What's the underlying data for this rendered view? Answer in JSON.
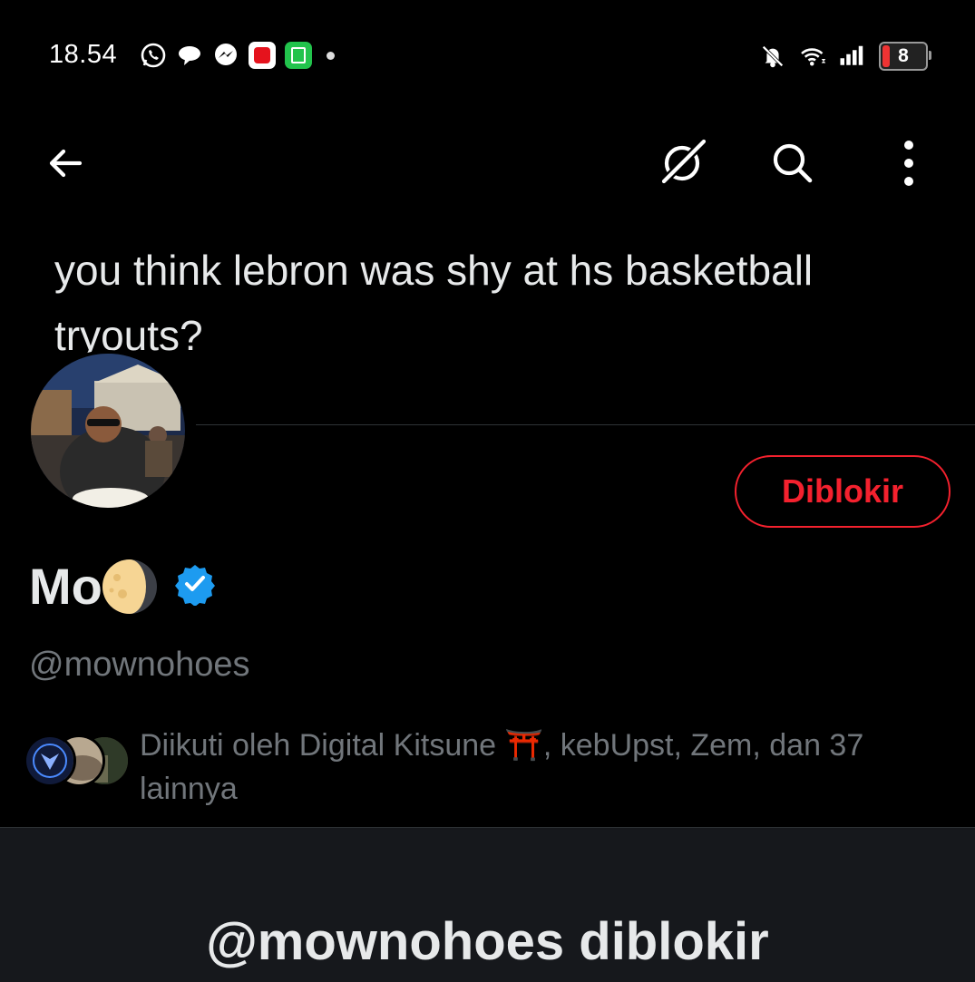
{
  "status_bar": {
    "time": "18.54",
    "notification_icons": [
      "whatsapp-icon",
      "chat-bubble-icon",
      "messenger-icon",
      "red-app-icon",
      "green-app-icon"
    ],
    "battery_level": "8",
    "battery_color": "#e33333"
  },
  "toolbar": {
    "back_icon": "arrow-left-icon",
    "grok_icon": "grok-icon",
    "search_icon": "search-icon",
    "more_icon": "more-vertical-icon"
  },
  "tweet": {
    "text": "you think lebron was shy at hs basketball tryouts?"
  },
  "profile": {
    "display_name": "Mo",
    "name_emoji": "moon-emoji",
    "verified": true,
    "handle": "@mownohoes",
    "blocked_button_label": "Diblokir",
    "followed_by_text": "Diikuti oleh Digital Kitsune ⛩️, kebUpst, Zem, dan 37 lainnya"
  },
  "banner": {
    "title": "@mownohoes diblokir"
  },
  "colors": {
    "background": "#000000",
    "blocked_red": "#f4212e",
    "verified_blue": "#1d9bf0",
    "secondary_text": "#71767b",
    "panel_bg": "#16181c"
  }
}
